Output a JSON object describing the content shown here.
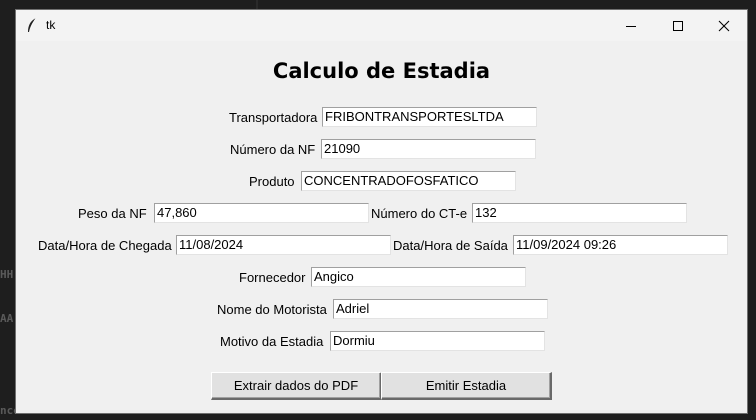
{
  "background": {
    "text_left_1": "HH",
    "text_left_2": "AA",
    "text_bottom": "nco"
  },
  "window": {
    "title": "tk",
    "icons": {
      "app": "feather-icon",
      "minimize": "minimize-icon",
      "maximize": "maximize-icon",
      "close": "close-icon"
    }
  },
  "form": {
    "heading": "Calculo de Estadia",
    "transportadora": {
      "label": "Transportadora",
      "value": "FRIBONTRANSPORTESLTDA"
    },
    "numero_nf": {
      "label": "Número da NF",
      "value": "21090"
    },
    "produto": {
      "label": "Produto",
      "value": "CONCENTRADOFOSFATICO"
    },
    "peso_nf": {
      "label": "Peso da NF",
      "value": "47,860"
    },
    "numero_cte": {
      "label": "Número do CT-e",
      "value": "132"
    },
    "chegada": {
      "label": "Data/Hora de Chegada",
      "value": "11/08/2024"
    },
    "saida": {
      "label": "Data/Hora de Saída",
      "value": "11/09/2024 09:26"
    },
    "fornecedor": {
      "label": "Fornecedor",
      "value": "Angico"
    },
    "motorista": {
      "label": "Nome do Motorista",
      "value": "Adriel"
    },
    "motivo": {
      "label": "Motivo da Estadia",
      "value": "Dormiu"
    }
  },
  "buttons": {
    "extract": "Extrair dados do PDF",
    "emit": "Emitir Estadia"
  }
}
